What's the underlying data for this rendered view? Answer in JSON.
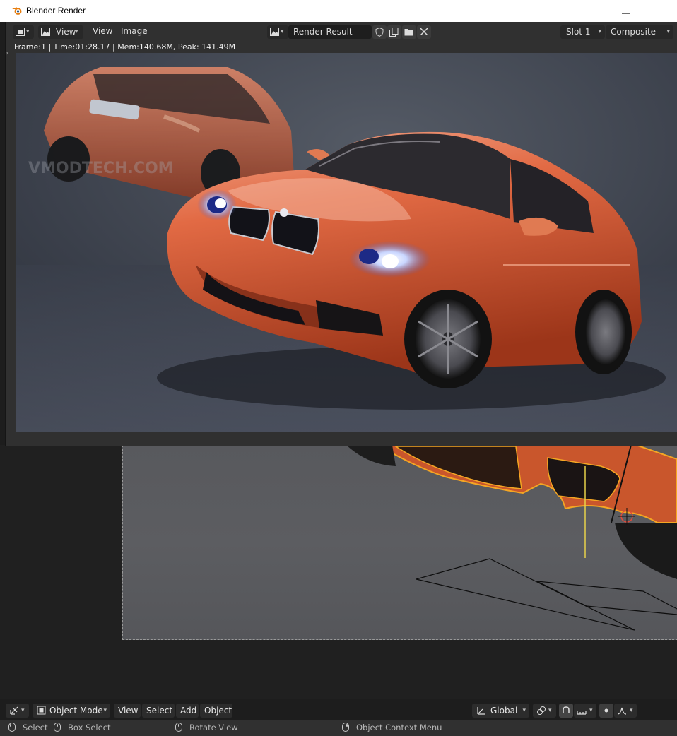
{
  "render_window": {
    "title": "Blender Render",
    "header": {
      "view_menu_dropdown": "View",
      "menus": [
        "View",
        "Image"
      ],
      "image_name": "Render Result",
      "slot": "Slot 1",
      "layer": "Composite"
    },
    "stats": "Frame:1 | Time:01:28.17 | Mem:140.68M, Peak: 141.49M",
    "watermark": "VMODTECH.COM"
  },
  "viewport_header": {
    "mode": "Object Mode",
    "menus": [
      "View",
      "Select",
      "Add",
      "Object"
    ],
    "transform_orientation": "Global"
  },
  "status_bar": {
    "select": "Select",
    "box_select": "Box Select",
    "rotate_view": "Rotate View",
    "context_menu": "Object Context Menu"
  },
  "colors": {
    "accent_orange": "#f5a623",
    "car_paint": "#d9542f",
    "ui_background": "#303030",
    "header_background": "#1d1d1d"
  },
  "icons": {
    "window": [
      "blender-logo-icon",
      "minimize-icon",
      "maximize-icon"
    ],
    "image_editor": [
      "editor-type-icon",
      "image-icon",
      "fake-user-shield-icon",
      "duplicate-icon",
      "open-folder-icon",
      "close-icon"
    ],
    "viewport": [
      "editor-type-3d-icon",
      "object-mode-icon",
      "transform-orientation-icon",
      "pivot-icon",
      "snap-icon",
      "snap-increment-icon",
      "proportional-edit-icon",
      "falloff-icon"
    ]
  }
}
